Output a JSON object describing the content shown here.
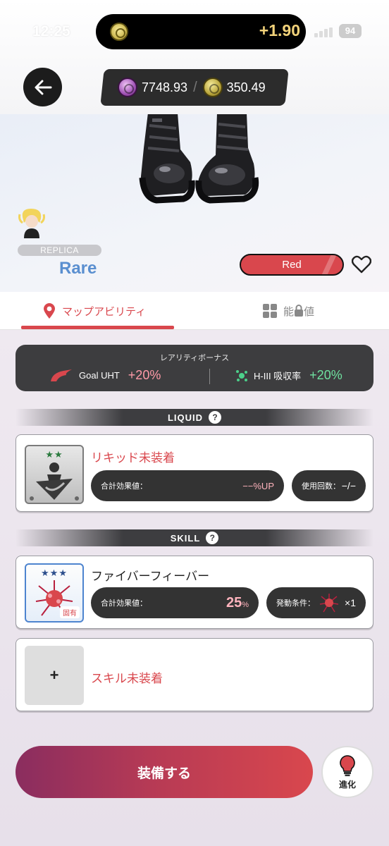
{
  "status_bar": {
    "time": "12:25",
    "island_value": "+1.90",
    "battery": "94"
  },
  "header": {
    "currency_a": "7748.93",
    "currency_b": "350.49"
  },
  "item": {
    "tier": "REPLICA",
    "rarity": "Rare",
    "color": "Red"
  },
  "tabs": {
    "map_ability": "マップアビリティ",
    "ability_value_prefix": "能",
    "ability_value_suffix": "値"
  },
  "bonus": {
    "title": "レアリティボーナス",
    "left_label": "Goal UHT",
    "left_value": "+20%",
    "right_label": "H-III 吸収率",
    "right_value": "+20%"
  },
  "liquid": {
    "section": "LIQUID",
    "help": "?",
    "stars": "★★",
    "title": "リキッド未装着",
    "effect_label": "合計効果値：",
    "effect_value": "−−%UP",
    "uses_label": "使用回数：",
    "uses_value": "−/−"
  },
  "skill": {
    "section": "SKILL",
    "help": "?",
    "stars": "★★★",
    "badge": "固有",
    "title": "ファイバーフィーバー",
    "effect_label": "合計効果値：",
    "effect_value": "25",
    "effect_unit": "%",
    "condition_label": "発動条件：",
    "condition_value": "×1",
    "empty_slot_plus": "+",
    "empty_slot_title": "スキル未装着"
  },
  "actions": {
    "equip": "装備する",
    "evolve": "進化"
  },
  "colors": {
    "accent": "#d9474d",
    "rarity_blue": "#5a8fd0",
    "dark_panel": "#3d3d3f"
  }
}
